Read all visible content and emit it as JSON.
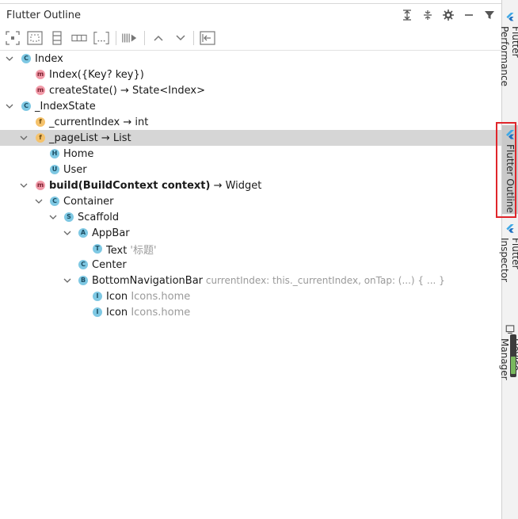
{
  "panel": {
    "title": "Flutter Outline",
    "header_icons": [
      "expand-all-icon",
      "collapse-all-icon",
      "gear-icon",
      "minimize-icon",
      "filter-icon"
    ]
  },
  "toolbar": {
    "buttons": [
      "wrap-center-icon",
      "wrap-padding-icon",
      "wrap-column-icon",
      "wrap-row-icon",
      "wrap-widget-icon",
      "extract-method-icon",
      "move-up-icon",
      "move-down-icon",
      "remove-widget-icon"
    ]
  },
  "colors": {
    "class_badge": "#7ec8e3",
    "method_badge": "#f19aa8",
    "field_badge": "#f5c26b",
    "widget_badge": "#7ec8e3",
    "selected_row": "#d6d6d6",
    "highlight_box": "#e0262b"
  },
  "tree": [
    {
      "badge": "C",
      "text": "Index",
      "hint": ""
    },
    {
      "badge": "m",
      "text": "Index({Key? key})",
      "hint": ""
    },
    {
      "badge": "m",
      "text": "createState() → State<Index>",
      "hint": ""
    },
    {
      "badge": "C",
      "text": "_IndexState",
      "hint": ""
    },
    {
      "badge": "f",
      "text": "_currentIndex → int",
      "hint": ""
    },
    {
      "badge": "f",
      "text": "_pageList → List",
      "hint": ""
    },
    {
      "badge": "H",
      "text": "Home",
      "hint": ""
    },
    {
      "badge": "U",
      "text": "User",
      "hint": ""
    },
    {
      "badge": "m",
      "text_bold": "build(BuildContext context)",
      "text": " → Widget",
      "hint": ""
    },
    {
      "badge": "C",
      "text": "Container",
      "hint": ""
    },
    {
      "badge": "S",
      "text": "Scaffold",
      "hint": ""
    },
    {
      "badge": "A",
      "text": "AppBar",
      "hint": ""
    },
    {
      "badge": "T",
      "text": "Text",
      "hint": " '标题'"
    },
    {
      "badge": "C",
      "text": "Center",
      "hint": ""
    },
    {
      "badge": "B",
      "text": "BottomNavigationBar",
      "hint": " currentIndex: this._currentIndex, onTap: (...) { ... }"
    },
    {
      "badge": "I",
      "text": "Icon",
      "hint": " Icons.home"
    },
    {
      "badge": "I",
      "text": "Icon",
      "hint": " Icons.home"
    }
  ],
  "right_tabs": [
    {
      "label": "Flutter Performance",
      "active": false
    },
    {
      "label": "Flutter Outline",
      "active": true
    },
    {
      "label": "Flutter Inspector",
      "active": false
    },
    {
      "label": "Device Manager",
      "active": false
    }
  ]
}
